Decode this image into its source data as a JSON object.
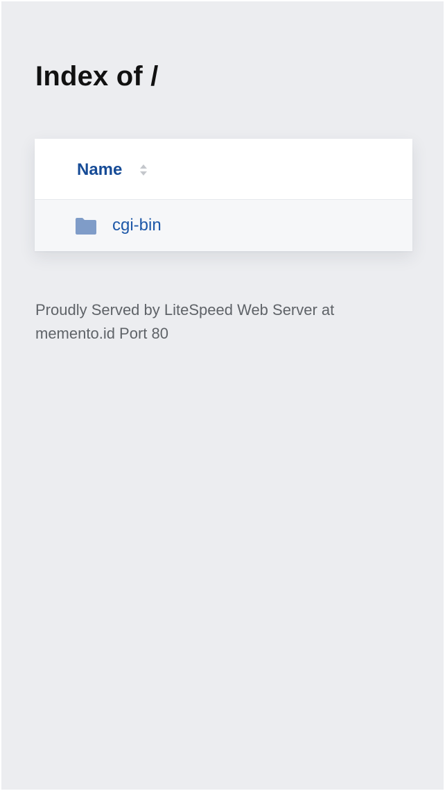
{
  "page": {
    "title": "Index of /"
  },
  "table": {
    "column_name_label": "Name",
    "sort_icon": "sort-up-down-icon",
    "rows": [
      {
        "icon": "folder-icon",
        "label": "cgi-bin"
      }
    ]
  },
  "footer": {
    "line1": "Proudly Served by LiteSpeed Web Server at",
    "line2": "memento.id Port 80"
  },
  "colors": {
    "background": "#ecedf0",
    "link": "#1e58a8",
    "header_link": "#164b96",
    "folder_icon": "#7f9cc8"
  }
}
